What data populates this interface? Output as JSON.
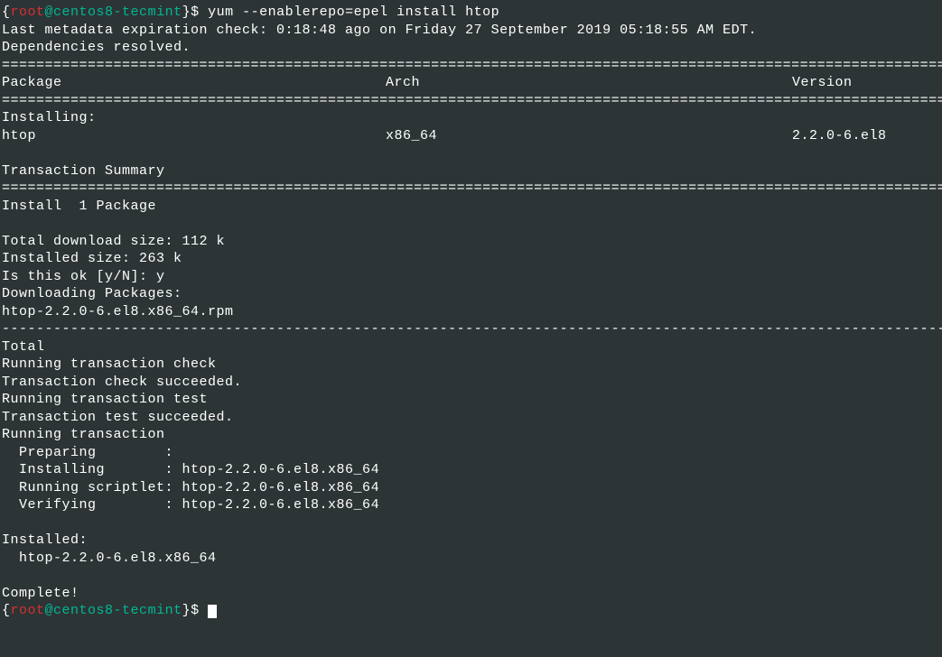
{
  "prompt1": {
    "brace_open": "{",
    "user": "root",
    "at": "@",
    "host": "centos8-tecmint",
    "brace_close": "}",
    "dollar": "$ ",
    "command": "yum --enablerepo=epel install htop"
  },
  "line_metadata": "Last metadata expiration check: 0:18:48 ago on Friday 27 September 2019 05:18:55 AM EDT.",
  "line_deps": "Dependencies resolved.",
  "divider_eq": "=================================================================================================================",
  "header": {
    "package": " Package",
    "arch": "Arch",
    "version": "Version"
  },
  "section_installing": "Installing:",
  "pkg_row": {
    "name": " htop",
    "arch": "x86_64",
    "version": "2.2.0-6.el8"
  },
  "section_trans_summary": "Transaction Summary",
  "line_install_count": "Install  1 Package",
  "blank": " ",
  "line_dl_size": "Total download size: 112 k",
  "line_inst_size": "Installed size: 263 k",
  "line_confirm": "Is this ok [y/N]: y",
  "line_downloading": "Downloading Packages:",
  "line_rpm": "htop-2.2.0-6.el8.x86_64.rpm",
  "divider_dash": "-----------------------------------------------------------------------------------------------------------------",
  "line_total": "Total",
  "line_run_check": "Running transaction check",
  "line_check_ok": "Transaction check succeeded.",
  "line_run_test": "Running transaction test",
  "line_test_ok": "Transaction test succeeded.",
  "line_run_trans": "Running transaction",
  "line_preparing": "  Preparing        :",
  "line_installing": "  Installing       : htop-2.2.0-6.el8.x86_64",
  "line_scriptlet": "  Running scriptlet: htop-2.2.0-6.el8.x86_64",
  "line_verifying": "  Verifying        : htop-2.2.0-6.el8.x86_64",
  "line_installed_hdr": "Installed:",
  "line_installed_pkg": "  htop-2.2.0-6.el8.x86_64",
  "line_complete": "Complete!",
  "prompt2": {
    "brace_open": "{",
    "user": "root",
    "at": "@",
    "host": "centos8-tecmint",
    "brace_close": "}",
    "dollar": "$ "
  }
}
